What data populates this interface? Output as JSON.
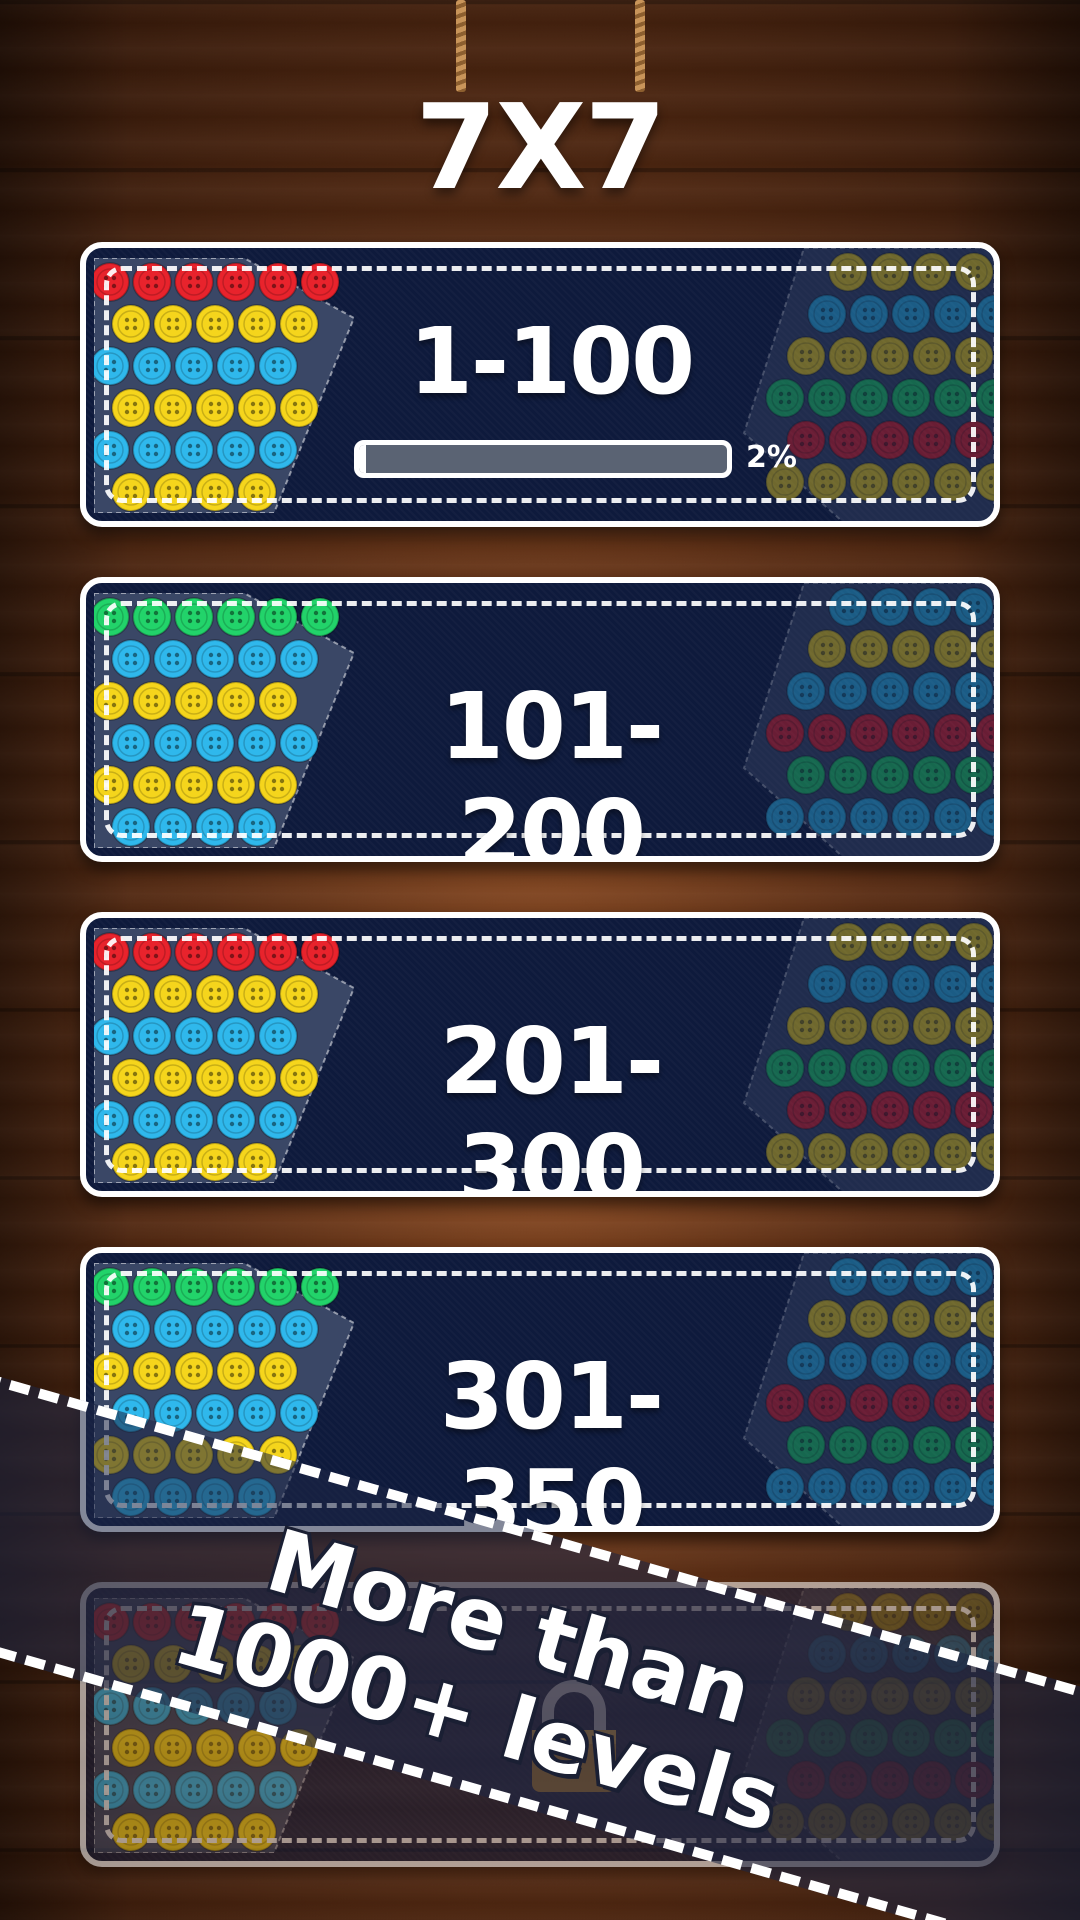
{
  "title": "7X7",
  "colors": {
    "card_bg": "#0e1a3c",
    "border": "#ffffff",
    "button_red": "#e8232c",
    "button_yellow": "#f5d51c",
    "button_green": "#22d36a",
    "button_blue": "#2fb8ec",
    "progress_track": "#5a6373"
  },
  "levels": [
    {
      "range": "1-100",
      "progress_percent": 2,
      "progress_label": "2%",
      "locked": false
    },
    {
      "range": "101-200",
      "locked": false
    },
    {
      "range": "201-300",
      "locked": false
    },
    {
      "range": "301-350",
      "locked": false
    },
    {
      "range": "",
      "locked": true,
      "icon": "lock-icon"
    }
  ],
  "banner": {
    "line1": "More than",
    "line2": "1000+ levels"
  }
}
